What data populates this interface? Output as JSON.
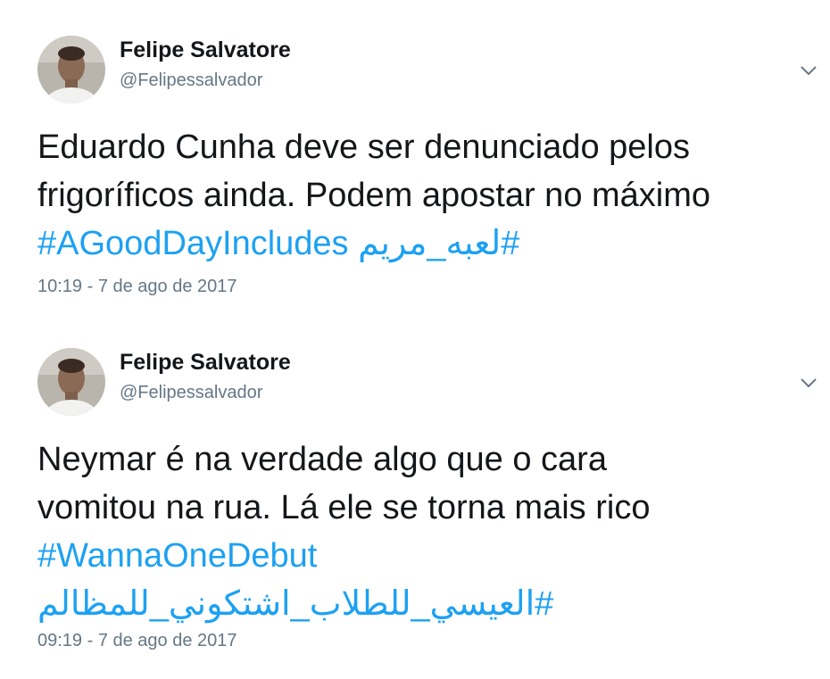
{
  "tweets": [
    {
      "author_name": "Felipe Salvatore",
      "author_handle": "@Felipessalvador",
      "text_lines": [
        "Eduardo Cunha deve ser denunciado pelos",
        "frigoríficos ainda. Podem apostar no máximo"
      ],
      "hashtags_line": [
        "#AGoodDayIncludes",
        "#لعبه_مريم"
      ],
      "timestamp": "10:19 - 7 de ago de 2017",
      "menu_icon": "chevron-down-icon"
    },
    {
      "author_name": "Felipe Salvatore",
      "author_handle": "@Felipessalvador",
      "text_lines": [
        "Neymar é na verdade algo que o cara",
        "vomitou na rua. Lá ele se torna mais rico"
      ],
      "hashtags": [
        "#WannaOneDebut",
        "#العيسي_للطلاب_اشتكوني_للمظالم"
      ],
      "timestamp": "09:19 - 7 de ago de 2017",
      "menu_icon": "chevron-down-icon"
    }
  ],
  "colors": {
    "text": "#14171a",
    "secondary": "#657786",
    "link": "#1da1f2"
  }
}
